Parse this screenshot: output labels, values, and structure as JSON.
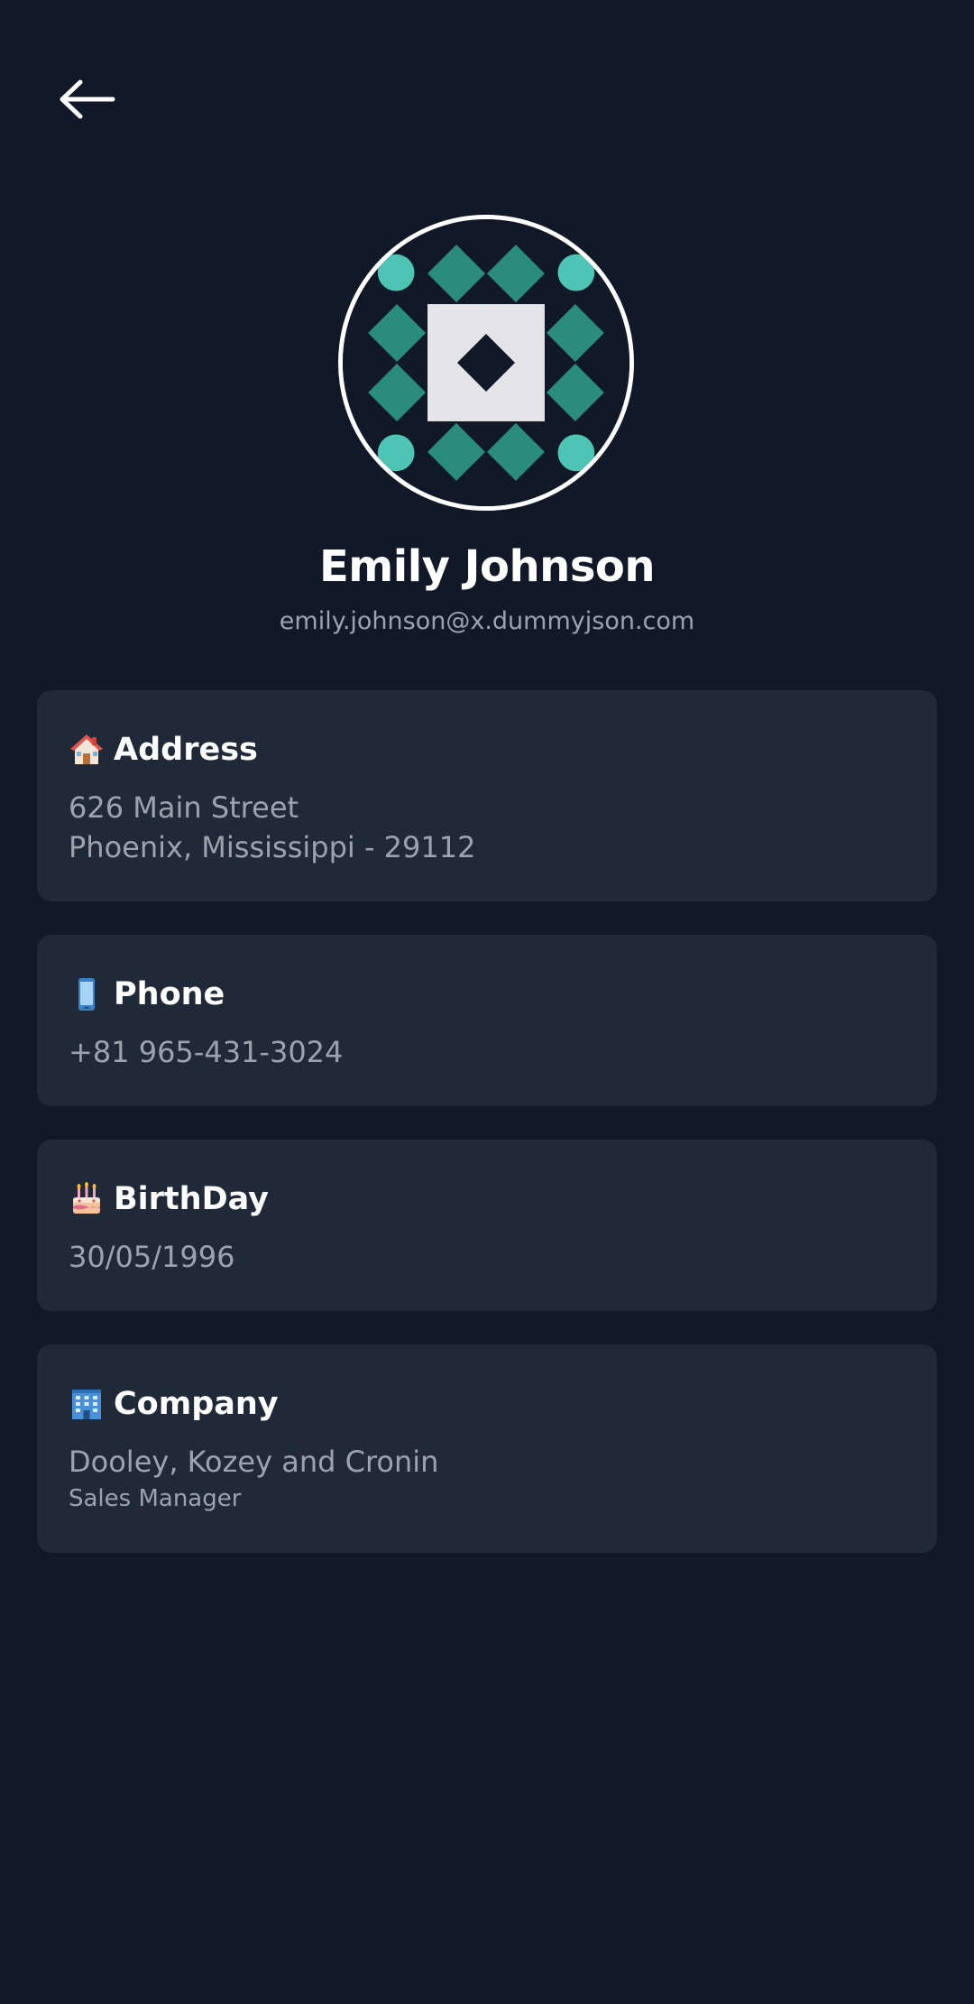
{
  "header": {
    "back_icon": "arrow-left-icon"
  },
  "profile": {
    "avatar_icon": "identicon-avatar",
    "name": "Emily Johnson",
    "email": "emily.johnson@x.dummyjson.com"
  },
  "cards": {
    "address": {
      "icon": "house-icon",
      "title": "Address",
      "line1": "626 Main Street",
      "line2": "Phoenix, Mississippi - 29112"
    },
    "phone": {
      "icon": "mobile-phone-icon",
      "title": "Phone",
      "value": "+81 965-431-3024"
    },
    "birthday": {
      "icon": "birthday-cake-icon",
      "title": "BirthDay",
      "value": "30/05/1996"
    },
    "company": {
      "icon": "office-building-icon",
      "title": "Company",
      "name": "Dooley, Kozey and Cronin",
      "role": "Sales Manager"
    }
  },
  "colors": {
    "background": "#111827",
    "card": "#1f2937",
    "text_primary": "#ffffff",
    "text_secondary": "#9ca3af",
    "avatar_teal": "#2a8c7c",
    "avatar_mint": "#4ec4b4"
  }
}
